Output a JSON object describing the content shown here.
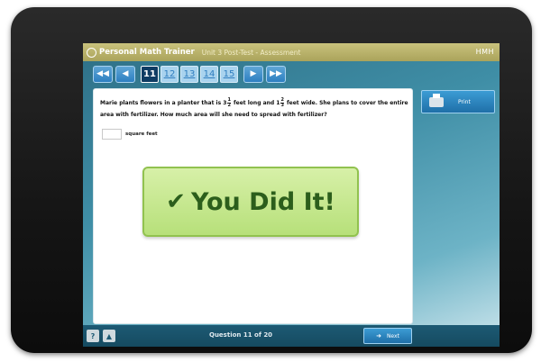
{
  "app": {
    "title": "Personal Math Trainer",
    "subtitle": "Unit 3 Post-Test - Assessment",
    "brand": "HMH"
  },
  "nav": {
    "first_icon": "◀◀",
    "prev_icon": "◀",
    "next_icon": "▶",
    "last_icon": "▶▶",
    "pages": [
      "11",
      "12",
      "13",
      "14",
      "15"
    ],
    "current_page": "11"
  },
  "question": {
    "text_part1": "Marie plants flowers in a planter that is 3",
    "frac1_num": "1",
    "frac1_den": "2",
    "text_part2": "feet long and 1",
    "frac2_num": "2",
    "frac2_den": "3",
    "text_part3": "feet wide. She plans to cover the entire area with fertilizer. How much area will she need to spread with fertilizer?",
    "answer_value": "",
    "unit_label": "square feet"
  },
  "result": {
    "message": "You Did It!",
    "icon": "check-icon"
  },
  "sidebar": {
    "print_label": "Print"
  },
  "footer": {
    "help_icon": "?",
    "tools_icon": "▲",
    "counter_prefix": "Question",
    "counter_current": "11",
    "counter_of": "of",
    "counter_total": "20",
    "next_label": "Next"
  },
  "colors": {
    "banner_fill": "#c6e78e",
    "banner_text": "#2c5e1c",
    "header_band": "#b8b16a",
    "button_blue": "#2d7fc1"
  }
}
